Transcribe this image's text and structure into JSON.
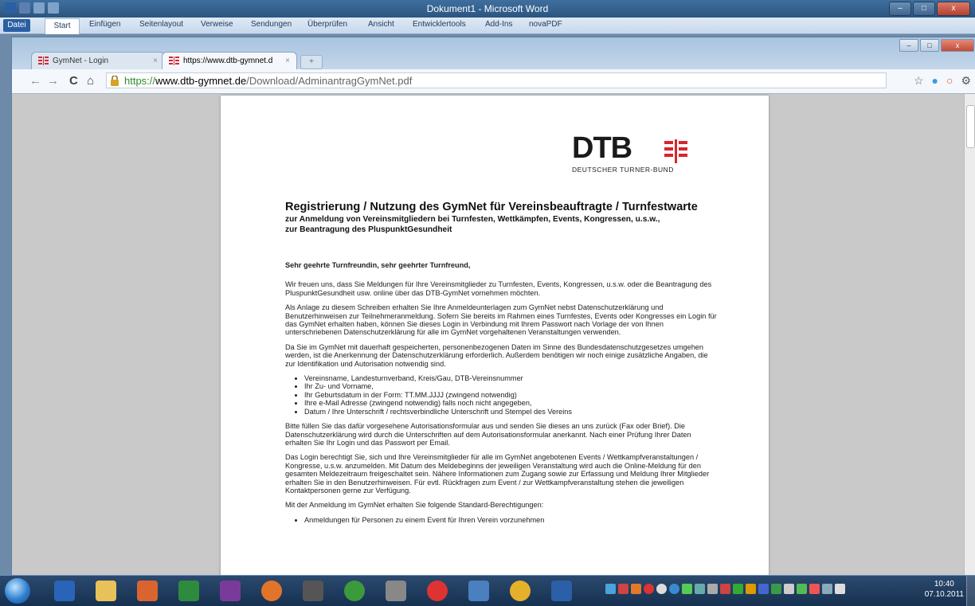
{
  "word": {
    "title": "Dokument1 - Microsoft Word",
    "tabs": [
      "Datei",
      "Start",
      "Einfügen",
      "Seitenlayout",
      "Verweise",
      "Sendungen",
      "Überprüfen",
      "Ansicht",
      "Entwicklertools",
      "Add-Ins",
      "novaPDF"
    ]
  },
  "browser": {
    "tabs": [
      {
        "label": "GymNet - Login",
        "close": "×"
      },
      {
        "label": "https://www.dtb-gymnet.d",
        "close": "×"
      }
    ],
    "new_tab": "+",
    "url_scheme": "https://",
    "url_host": "www.dtb-gymnet.de",
    "url_path": "/Download/AdminantragGymNet.pdf",
    "nav": {
      "back": "←",
      "forward": "→",
      "reload": "C",
      "home": "⌂"
    }
  },
  "pdf": {
    "logo_text": "DTB",
    "logo_sub": "DEUTSCHER TURNER-BUND",
    "title": "Registrierung / Nutzung des GymNet für Vereinsbeauftragte / Turnfestwarte",
    "subtitle1": "zur Anmeldung von Vereinsmitgliedern bei Turnfesten, Wettkämpfen, Events, Kongressen, u.s.w.,",
    "subtitle2": "zur Beantragung des PluspunktGesundheit",
    "salutation": "Sehr geehrte Turnfreundin, sehr geehrter Turnfreund,",
    "p1": "Wir freuen uns, dass Sie Meldungen für Ihre Vereinsmitglieder zu Turnfesten, Events, Kongressen, u.s.w. oder die Beantragung des PluspunktGesundheit usw. online über das DTB-GymNet vornehmen möchten.",
    "p2": "Als Anlage zu diesem Schreiben erhalten Sie Ihre Anmeldeunterlagen zum GymNet nebst Datenschutzerklärung und Benutzerhinweisen zur Teilnehmeranmeldung. Sofern Sie bereits im Rahmen eines Turnfestes, Events oder Kongresses ein Login für das GymNet erhalten haben, können Sie dieses Login in Verbindung mit Ihrem Passwort nach Vorlage der von Ihnen unterschriebenen Datenschutzerklärung für alle im GymNet vorgehaltenen Veranstaltungen verwenden.",
    "p3": "Da Sie im GymNet mit dauerhaft gespeicherten, personenbezogenen Daten im Sinne des Bundesdatenschutzgesetzes umgehen werden, ist die Anerkennung der Datenschutzerklärung erforderlich. Außerdem benötigen wir noch einige zusätzliche Angaben, die zur Identifikation und Autorisation notwendig sind.",
    "list": [
      "Vereinsname, Landesturnverband, Kreis/Gau, DTB-Vereinsnummer",
      "Ihr Zu- und Vorname,",
      "Ihr Geburtsdatum in der Form: TT.MM.JJJJ (zwingend notwendig)",
      "Ihre e-Mail Adresse (zwingend notwendig) falls noch nicht angegeben,",
      "Datum / Ihre Unterschrift / rechtsverbindliche Unterschrift und Stempel des Vereins"
    ],
    "p4": "Bitte füllen Sie das dafür vorgesehene Autorisationsformular aus und senden Sie dieses an uns zurück (Fax oder Brief). Die Datenschutzerklärung wird durch die Unterschriften auf dem Autorisationsformular anerkannt. Nach einer Prüfung Ihrer Daten erhalten Sie Ihr Login und das Passwort per Email.",
    "p5": "Das Login berechtigt Sie, sich und Ihre Vereinsmitglieder für alle im GymNet angebotenen Events / Wettkampfveranstaltungen / Kongresse, u.s.w. anzumelden. Mit Datum des Meldebeginns der jeweiligen Veranstaltung wird auch die Online-Meldung für den gesamten Meldezeitraum freigeschaltet sein. Nähere Informationen zum Zugang sowie zur Erfassung und Meldung Ihrer Mitglieder erhalten Sie in den Benutzerhinweisen. Für evtl. Rückfragen zum Event / zur Wettkampfveranstaltung stehen die jeweiligen Kontaktpersonen gerne zur Verfügung.",
    "p6": "Mit der Anmeldung im GymNet erhalten Sie folgende Standard-Berechtigungen:",
    "list2": [
      "Anmeldungen für Personen zu einem Event für Ihren Verein vorzunehmen"
    ]
  },
  "taskbar": {
    "time": "10:40",
    "date": "07.10.2011"
  },
  "colors": {
    "dtb_red": "#d7262e",
    "url_green": "#2f8a2f"
  }
}
